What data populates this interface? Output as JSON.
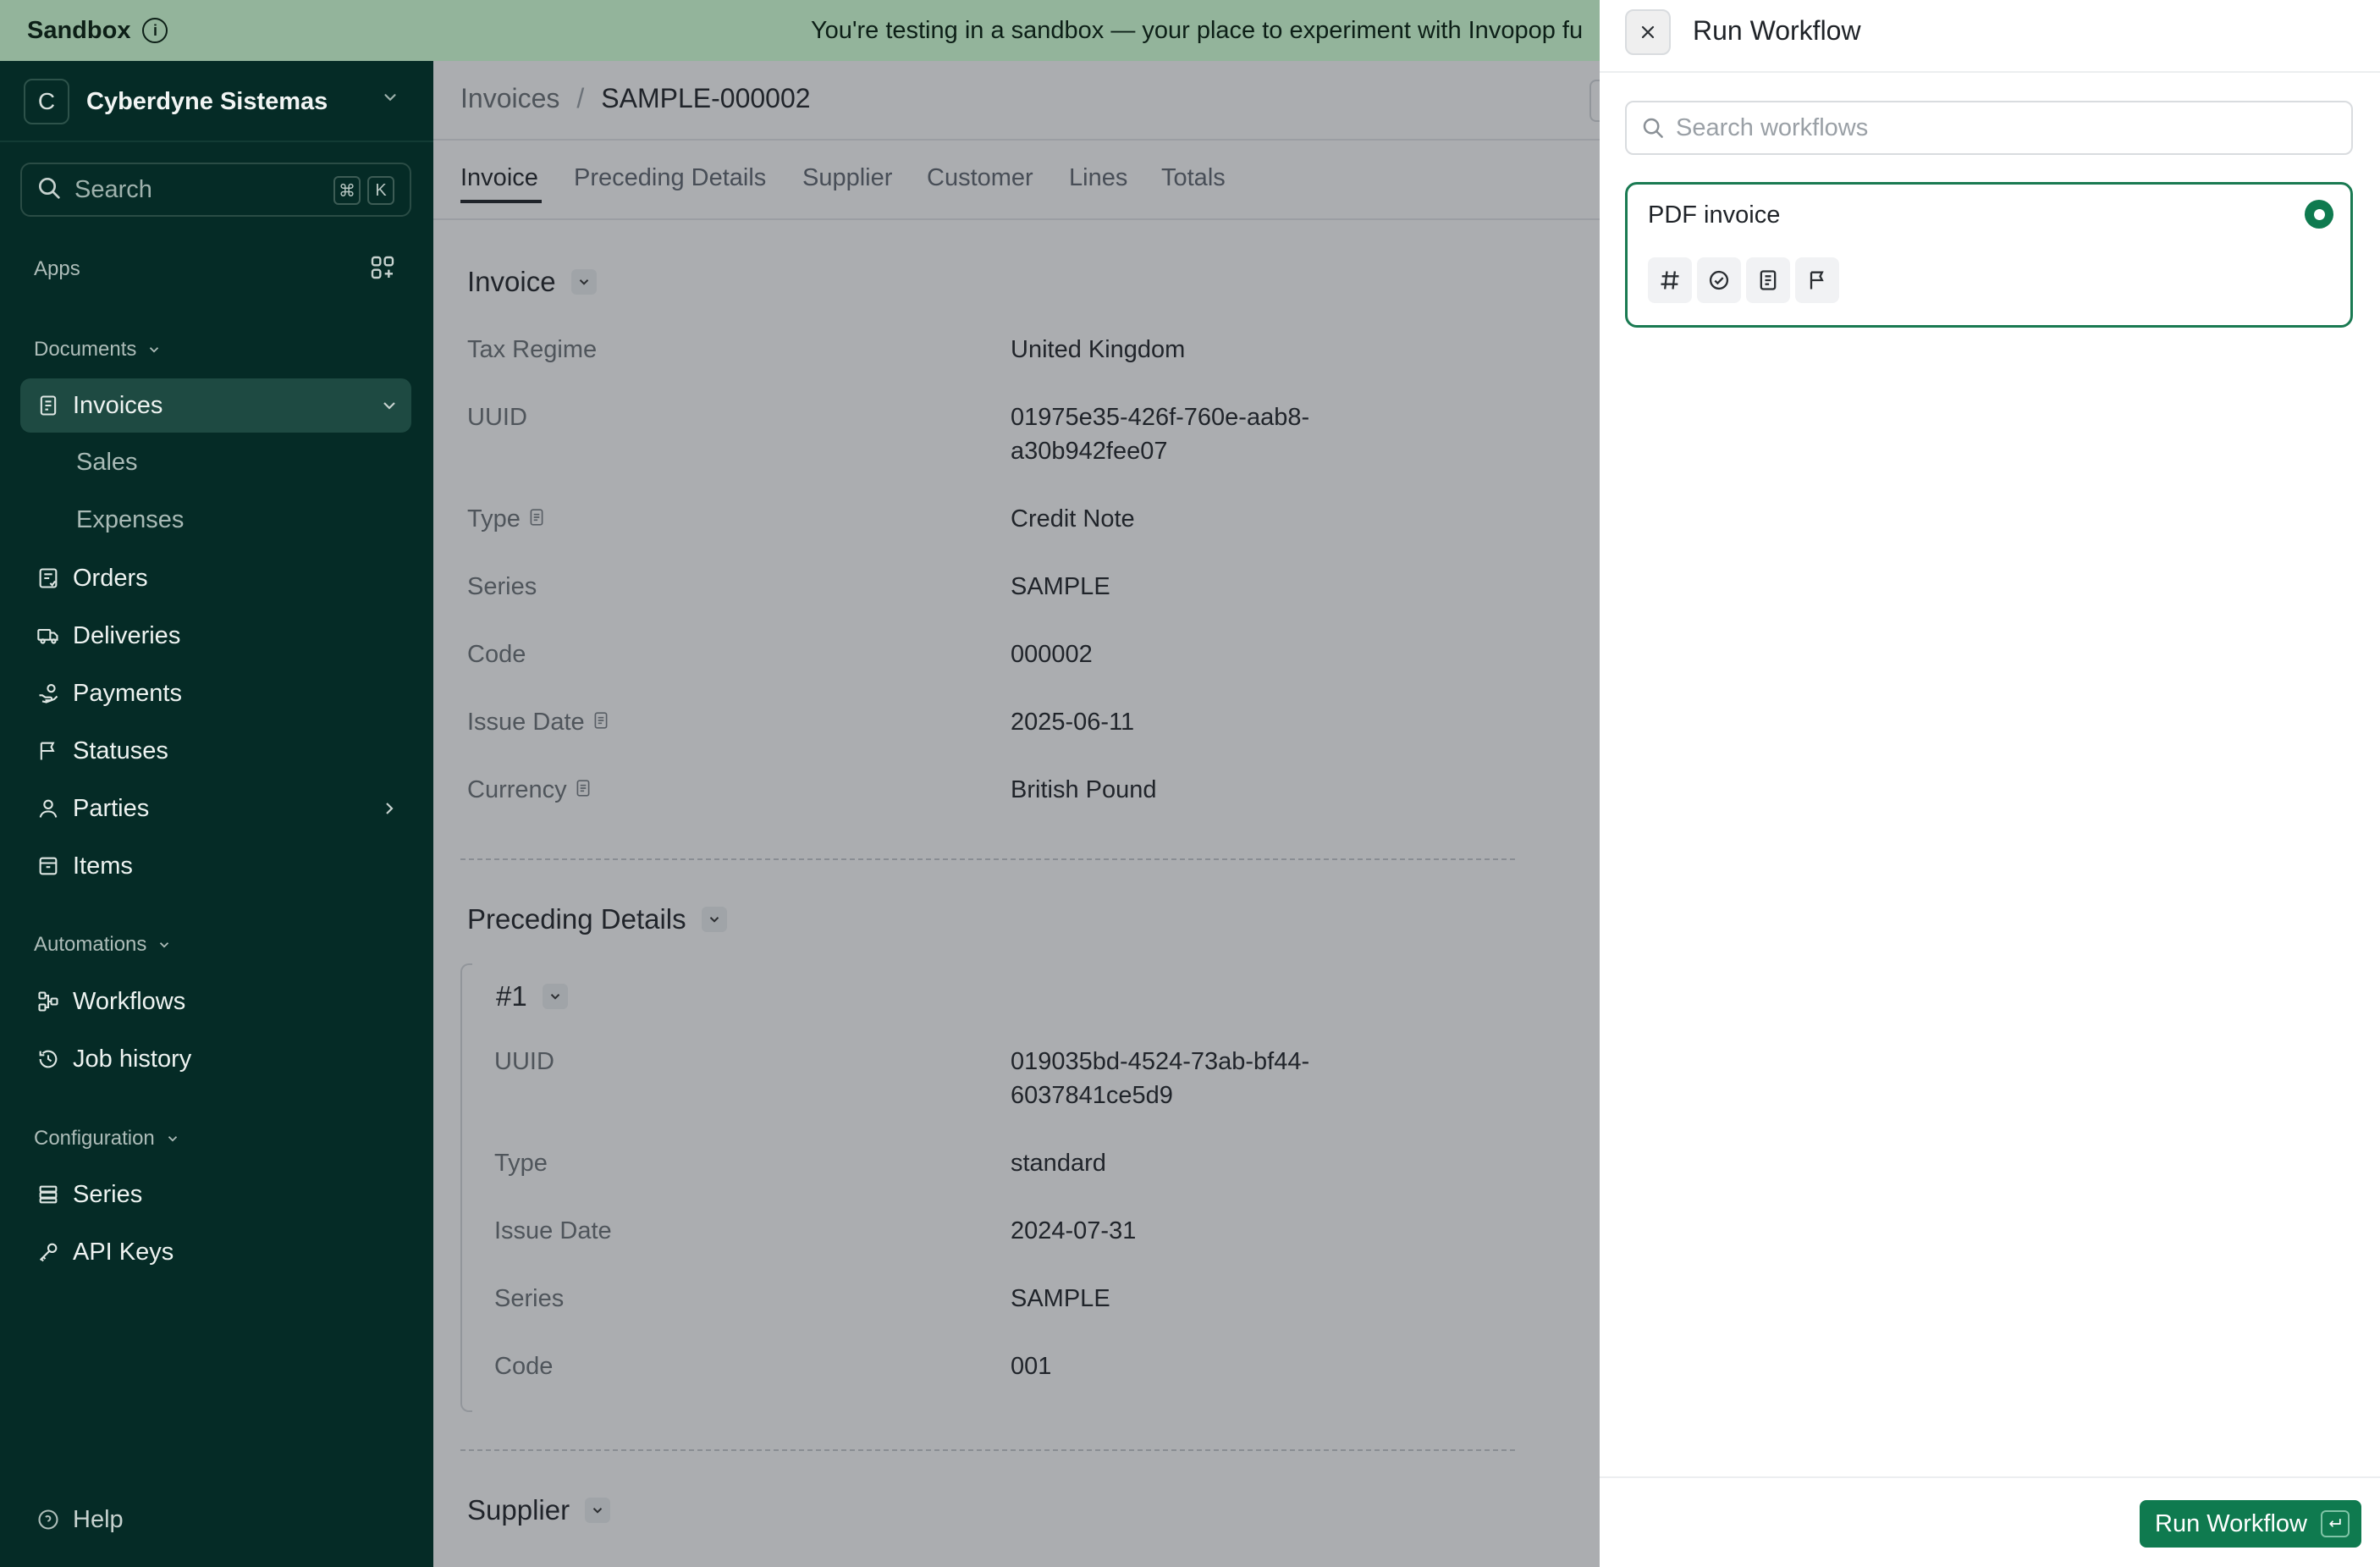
{
  "banner": {
    "title": "Sandbox",
    "message": "You're testing in a sandbox — your place to experiment with Invopop fu"
  },
  "sidebar": {
    "workspace": {
      "initial": "C",
      "name": "Cyberdyne Sistemas"
    },
    "search": {
      "placeholder": "Search",
      "shortcut_mod": "⌘",
      "shortcut_key": "K"
    },
    "apps_label": "Apps",
    "documents_label": "Documents",
    "invoices": {
      "label": "Invoices",
      "sub": [
        "Sales",
        "Expenses"
      ]
    },
    "document_items": [
      "Orders",
      "Deliveries",
      "Payments",
      "Statuses",
      "Parties",
      "Items"
    ],
    "automations_label": "Automations",
    "automation_items": [
      "Workflows",
      "Job history"
    ],
    "configuration_label": "Configuration",
    "configuration_items": [
      "Series",
      "API Keys"
    ],
    "help_label": "Help"
  },
  "main": {
    "breadcrumb": {
      "parent": "Invoices",
      "separator": "/",
      "current": "SAMPLE-000002"
    },
    "tabs": [
      "Invoice",
      "Preceding Details",
      "Supplier",
      "Customer",
      "Lines",
      "Totals"
    ],
    "invoice_section": {
      "title": "Invoice",
      "fields": [
        {
          "label": "Tax Regime",
          "value": "United Kingdom"
        },
        {
          "label": "UUID",
          "value": "01975e35-426f-760e-aab8-a30b942fee07"
        },
        {
          "label": "Type",
          "value": "Credit Note"
        },
        {
          "label": "Series",
          "value": "SAMPLE"
        },
        {
          "label": "Code",
          "value": "000002"
        },
        {
          "label": "Issue Date",
          "value": "2025-06-11"
        },
        {
          "label": "Currency",
          "value": "British Pound"
        }
      ]
    },
    "preceding_section": {
      "title": "Preceding Details",
      "item_title": "#1",
      "fields": [
        {
          "label": "UUID",
          "value": "019035bd-4524-73ab-bf44-6037841ce5d9"
        },
        {
          "label": "Type",
          "value": "standard"
        },
        {
          "label": "Issue Date",
          "value": "2024-07-31"
        },
        {
          "label": "Series",
          "value": "SAMPLE"
        },
        {
          "label": "Code",
          "value": "001"
        }
      ]
    },
    "supplier_section": {
      "title": "Supplier"
    }
  },
  "panel": {
    "title": "Run Workflow",
    "search_placeholder": "Search workflows",
    "workflow": {
      "name": "PDF invoice",
      "selected": true,
      "step_icons": [
        "hash-icon",
        "check-circle-icon",
        "document-icon",
        "flag-icon"
      ]
    },
    "run_button_label": "Run Workflow"
  },
  "colors": {
    "banner": "#93b49b",
    "sidebar": "#052b26",
    "accent": "#0f7a4f"
  }
}
